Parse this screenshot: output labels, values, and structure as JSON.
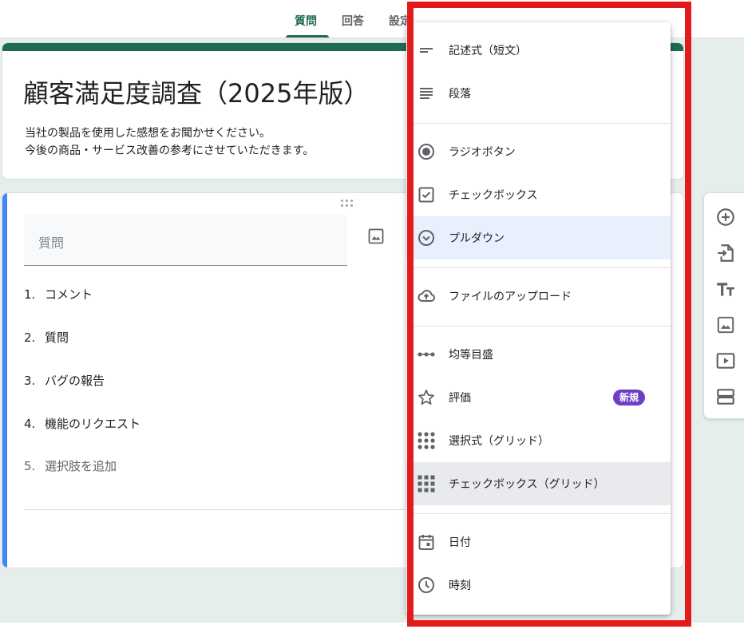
{
  "tabs": {
    "questions": "質問",
    "responses": "回答",
    "settings": "設定"
  },
  "form": {
    "title": "顧客満足度調査（2025年版）",
    "description_line1": "当社の製品を使用した感想をお聞かせください。",
    "description_line2": "今後の商品・サービス改善の参考にさせていただきます。"
  },
  "question": {
    "placeholder": "質問",
    "options": [
      {
        "num": "1.",
        "label": "コメント"
      },
      {
        "num": "2.",
        "label": "質問"
      },
      {
        "num": "3.",
        "label": "バグの報告"
      },
      {
        "num": "4.",
        "label": "機能のリクエスト"
      }
    ],
    "add_option": {
      "num": "5.",
      "label": "選択肢を追加"
    }
  },
  "menu": {
    "items": [
      {
        "label": "記述式（短文）",
        "icon": "short-answer-icon"
      },
      {
        "label": "段落",
        "icon": "paragraph-icon"
      },
      {
        "label": "ラジオボタン",
        "icon": "radio-button-icon"
      },
      {
        "label": "チェックボックス",
        "icon": "checkbox-icon"
      },
      {
        "label": "プルダウン",
        "icon": "dropdown-icon",
        "selected": true
      },
      {
        "label": "ファイルのアップロード",
        "icon": "cloud-upload-icon"
      },
      {
        "label": "均等目盛",
        "icon": "linear-scale-icon"
      },
      {
        "label": "評価",
        "icon": "star-icon",
        "badge": "新規"
      },
      {
        "label": "選択式（グリッド）",
        "icon": "grid-dots-icon"
      },
      {
        "label": "チェックボックス（グリッド）",
        "icon": "grid-squares-icon",
        "hovered": true
      },
      {
        "label": "日付",
        "icon": "calendar-icon"
      },
      {
        "label": "時刻",
        "icon": "clock-icon"
      }
    ]
  },
  "toolbar": {
    "icons": [
      "add-question-icon",
      "import-questions-icon",
      "add-title-icon",
      "add-image-icon",
      "add-video-icon",
      "add-section-icon"
    ]
  },
  "colors": {
    "theme": "#1e6b52",
    "question_accent": "#4285f4",
    "badge": "#6d3fc6",
    "annotation": "#e31b1b"
  }
}
